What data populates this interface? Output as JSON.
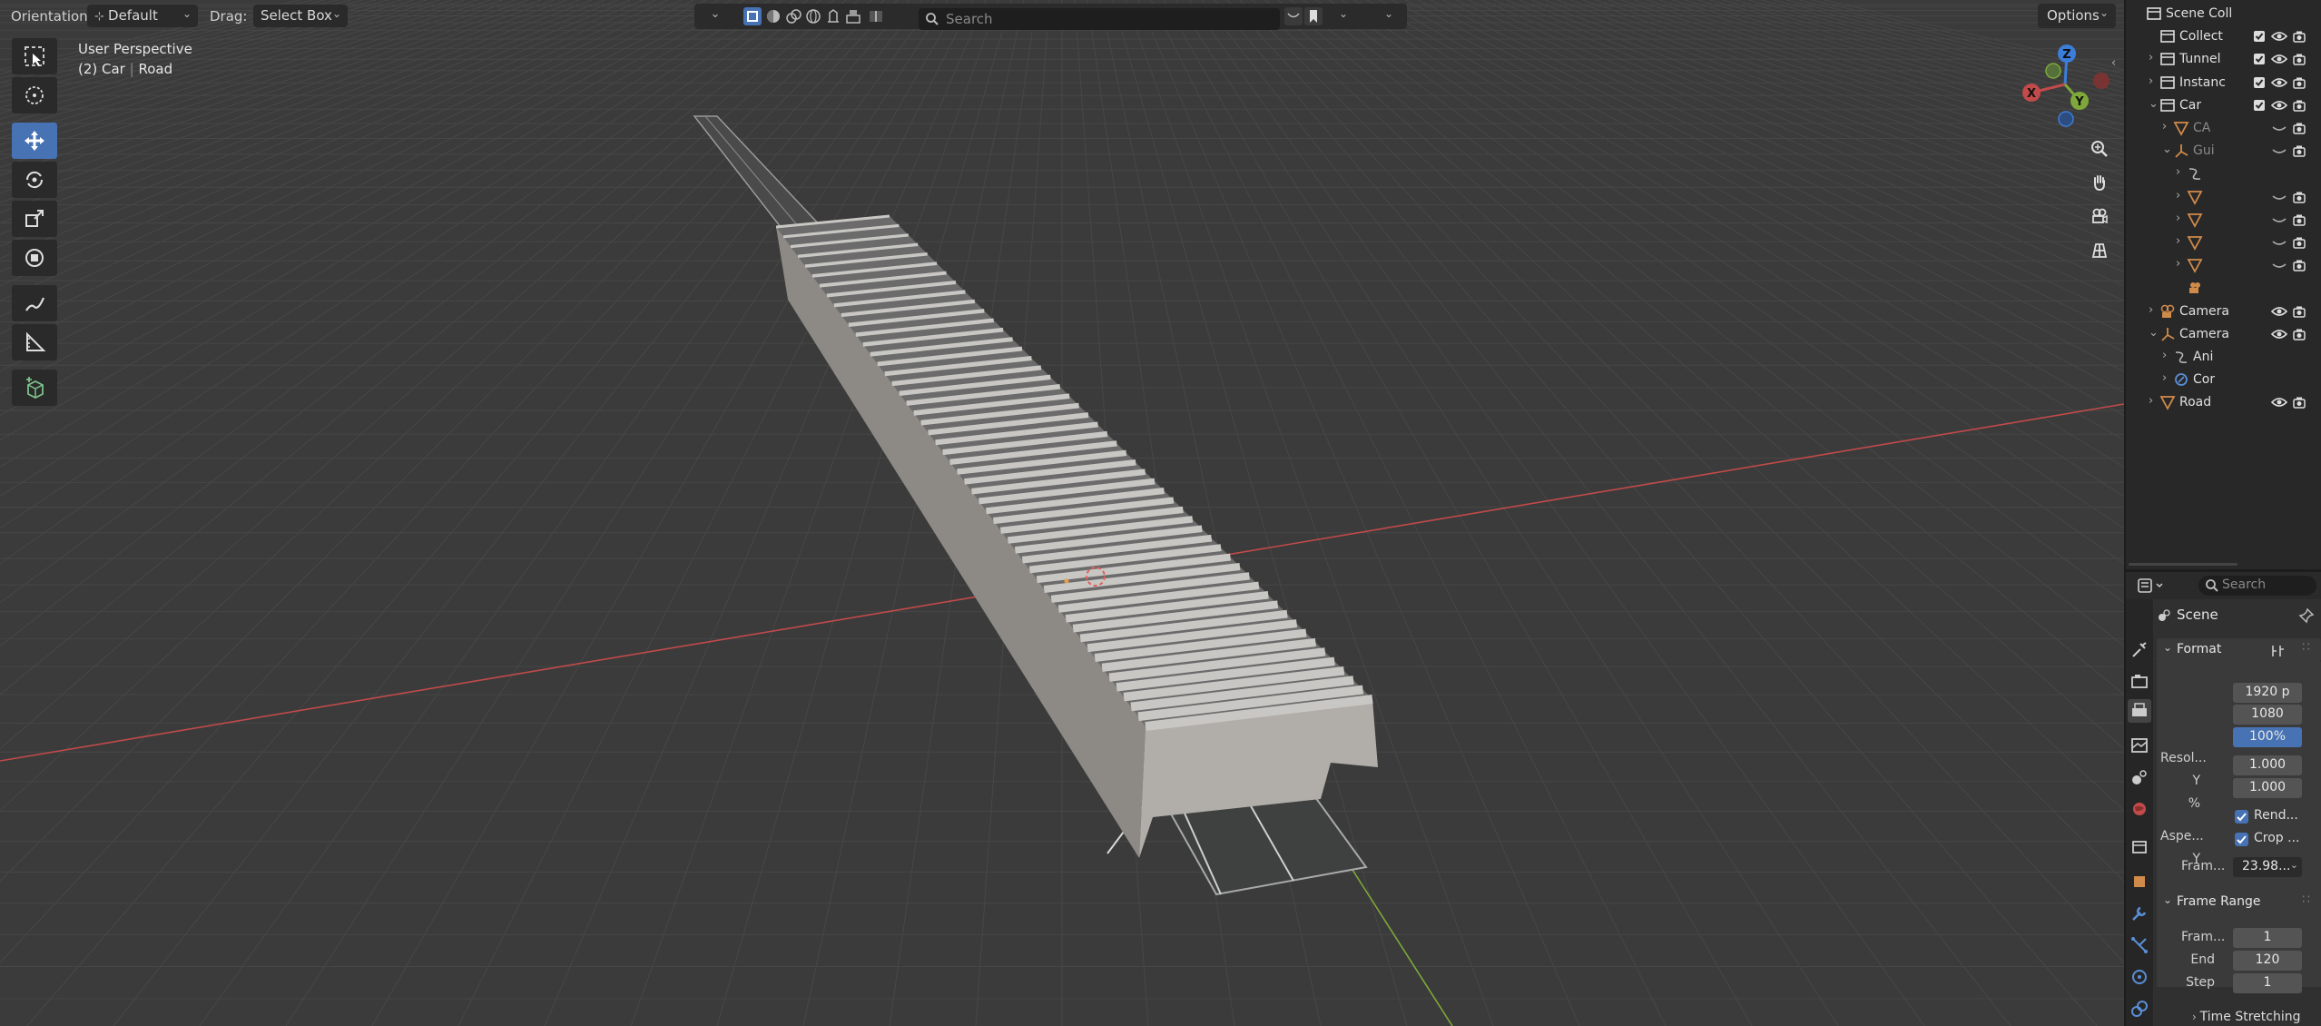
{
  "header": {
    "orientation_label": "Orientation:",
    "orientation_value": "Default",
    "drag_label": "Drag:",
    "drag_value": "Select Box",
    "search_placeholder": "Search",
    "options_label": "Options"
  },
  "viewport": {
    "perspective_label": "User Perspective",
    "context_collection": "(2) Car",
    "context_object": "Road",
    "gizmo_axes": [
      "Z",
      "X",
      "Y"
    ]
  },
  "outliner": {
    "rows": [
      {
        "label": "Scene Coll",
        "indent": 0,
        "icon": "collection-icon",
        "expand": "",
        "dim": false
      },
      {
        "label": "Collect",
        "indent": 1,
        "icon": "collection-icon",
        "expand": "",
        "dim": false
      },
      {
        "label": "Tunnel",
        "indent": 1,
        "icon": "collection-icon",
        "expand": "›",
        "dim": false
      },
      {
        "label": "Instanc",
        "indent": 1,
        "icon": "collection-icon",
        "expand": "›",
        "dim": false
      },
      {
        "label": "Car",
        "indent": 1,
        "icon": "collection-icon",
        "expand": "⌄",
        "dim": false
      },
      {
        "label": "CA",
        "indent": 2,
        "icon": "mesh-icon",
        "expand": "›",
        "dim": true
      },
      {
        "label": "Gui",
        "indent": 2,
        "icon": "empty-icon",
        "expand": "⌄",
        "dim": true
      },
      {
        "label": "",
        "indent": 3,
        "icon": "curve-icon",
        "expand": "›",
        "dim": true
      },
      {
        "label": "",
        "indent": 3,
        "icon": "mesh-icon",
        "expand": "›",
        "dim": true
      },
      {
        "label": "",
        "indent": 3,
        "icon": "mesh-icon",
        "expand": "›",
        "dim": true
      },
      {
        "label": "",
        "indent": 3,
        "icon": "mesh-icon",
        "expand": "›",
        "dim": true
      },
      {
        "label": "",
        "indent": 3,
        "icon": "mesh-icon",
        "expand": "›",
        "dim": true
      },
      {
        "label": "",
        "indent": 3,
        "icon": "camera-data-icon",
        "expand": "",
        "dim": true
      },
      {
        "label": "Camera",
        "indent": 1,
        "icon": "camera-object-icon",
        "expand": "›",
        "dim": false
      },
      {
        "label": "Camera",
        "indent": 1,
        "icon": "empty-icon",
        "expand": "⌄",
        "dim": false
      },
      {
        "label": "Ani",
        "indent": 2,
        "icon": "curve-icon",
        "expand": "›",
        "dim": false
      },
      {
        "label": "Cor",
        "indent": 2,
        "icon": "constraint-icon",
        "expand": "›",
        "dim": false
      },
      {
        "label": "Road",
        "indent": 1,
        "icon": "mesh-icon",
        "expand": "›",
        "dim": false
      }
    ]
  },
  "properties": {
    "search_placeholder": "Search",
    "scene_label": "Scene",
    "format_panel": "Format",
    "resolution_x_label": "Resol...",
    "resolution_x_value": "1920 p",
    "resolution_y_label": "Y",
    "resolution_y_value": "1080",
    "resolution_pct_label": "%",
    "resolution_pct_value": "100%",
    "aspect_x_label": "Aspe...",
    "aspect_x_value": "1.000",
    "aspect_y_label": "Y",
    "aspect_y_value": "1.000",
    "render_region_label": "Rend...",
    "crop_label": "Crop ...",
    "frame_rate_label": "Fram...",
    "frame_rate_value": "23.98...",
    "frame_range_panel": "Frame Range",
    "frame_start_label": "Fram...",
    "frame_start_value": "1",
    "frame_end_label": "End",
    "frame_end_value": "120",
    "frame_step_label": "Step",
    "frame_step_value": "1",
    "time_stretching_panel": "Time Stretching"
  },
  "colors": {
    "accent": "#4772b3",
    "viewport_bg": "#3b3b3b",
    "x_axis": "#c24a4a",
    "y_axis": "#7ea83a",
    "z_axis": "#3b7dd8",
    "mesh_icon": "#d08a4a"
  }
}
